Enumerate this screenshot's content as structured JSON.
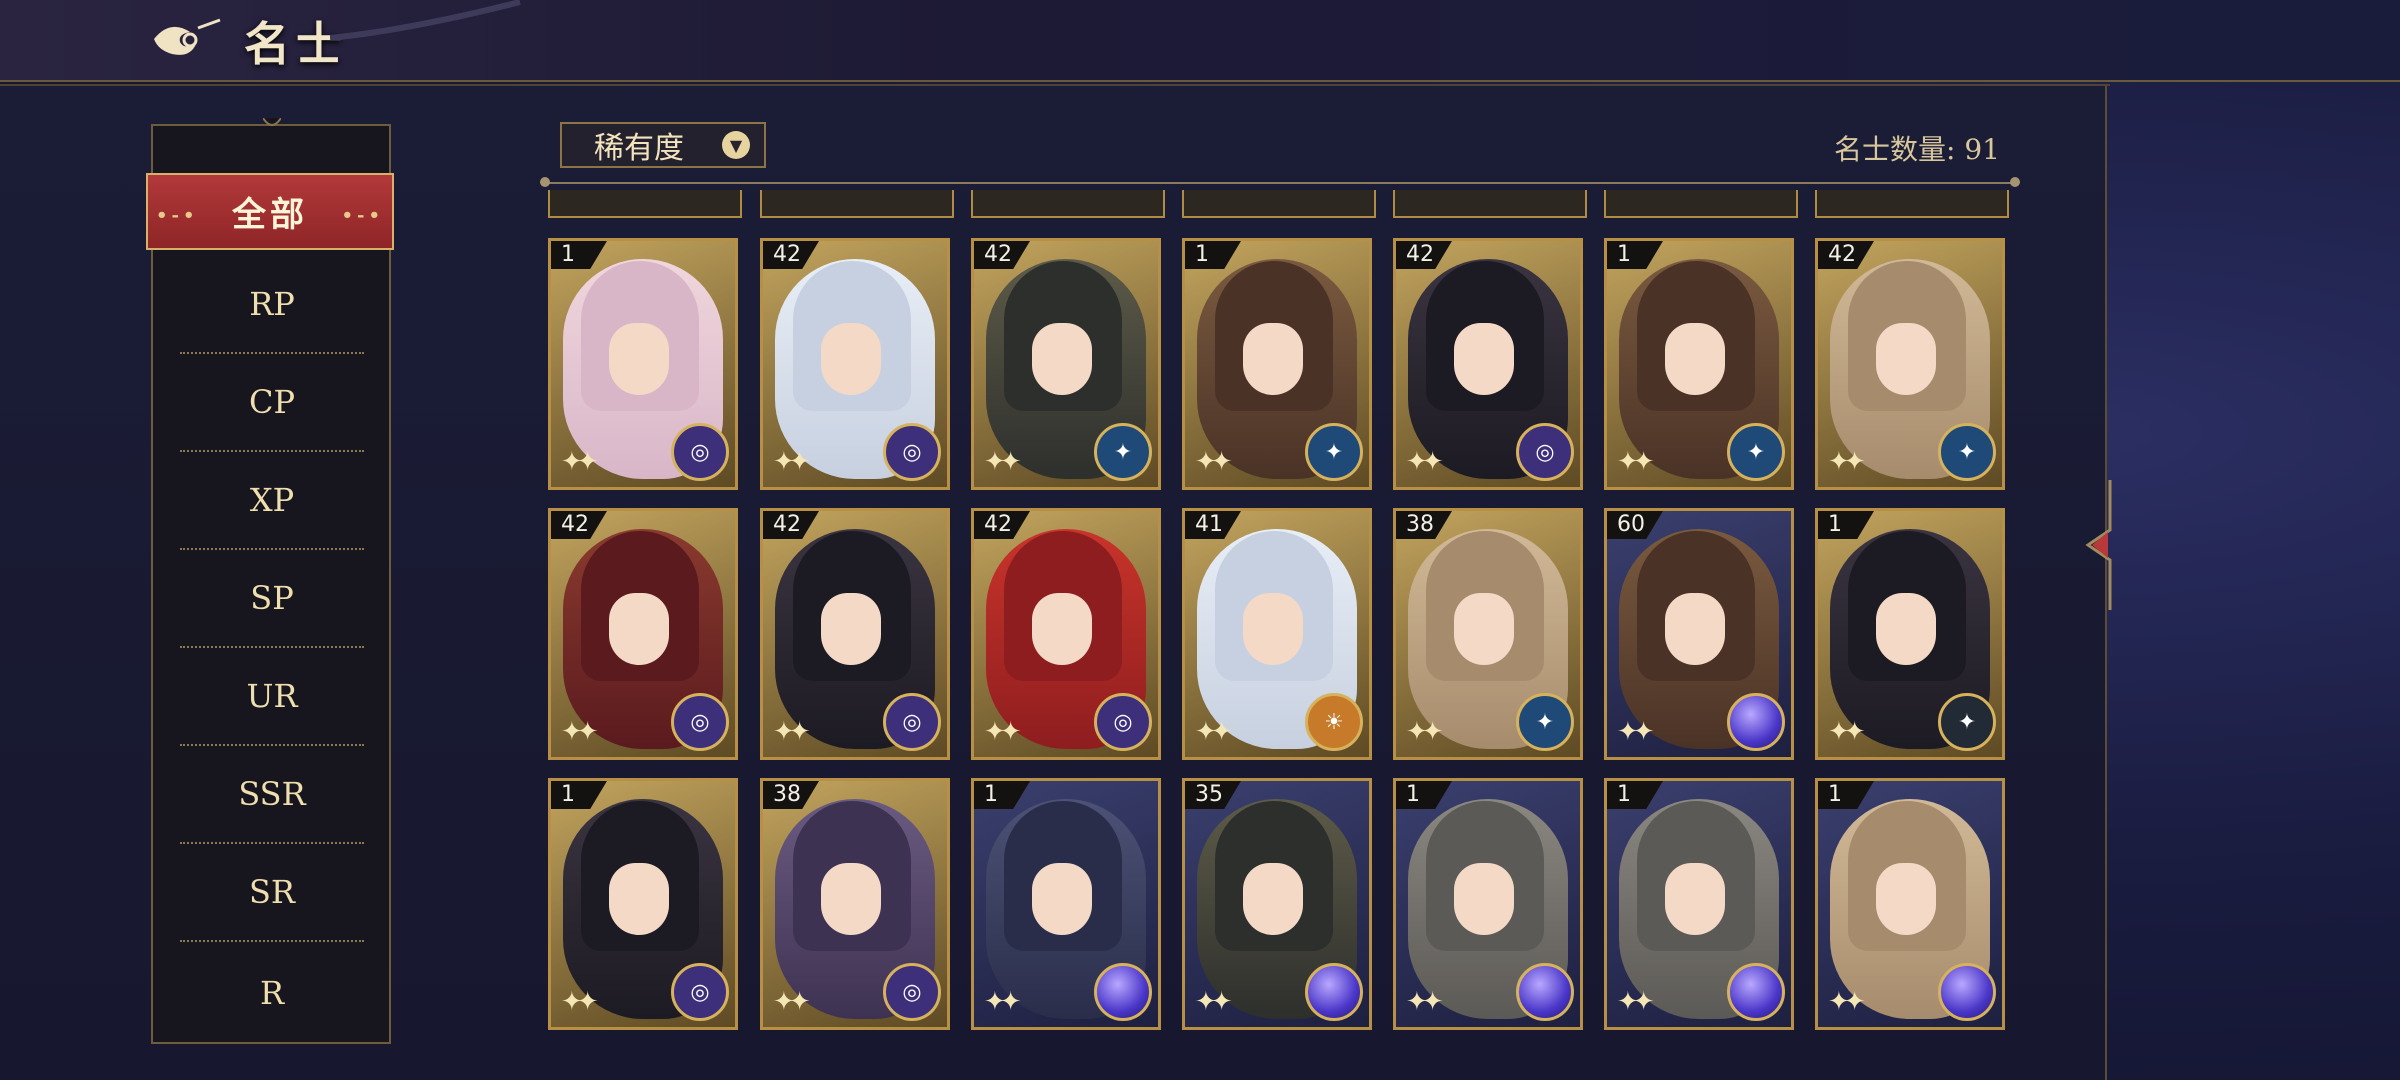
{
  "header": {
    "title": "名士"
  },
  "sidebar": {
    "active": "全部",
    "items": [
      "RP",
      "CP",
      "XP",
      "SP",
      "UR",
      "SSR",
      "SR",
      "R"
    ]
  },
  "toolbar": {
    "filter_label": "稀有度",
    "count_label": "名士数量:",
    "count_value": "91"
  },
  "colors": {
    "accent_gold": "#b89045",
    "active_red": "#9e2d2f",
    "panel_bg": "#17182f",
    "badge_purple": "#4a3a8a",
    "badge_blue": "#1f4a78",
    "badge_orb": "#5b49d6"
  },
  "cards": [
    {
      "level": "1",
      "badge": "purple-planet",
      "tone": "pink"
    },
    {
      "level": "42",
      "badge": "purple-planet",
      "tone": "silver"
    },
    {
      "level": "42",
      "badge": "blue-star",
      "tone": "dark"
    },
    {
      "level": "1",
      "badge": "blue-star",
      "tone": "brown"
    },
    {
      "level": "42",
      "badge": "purple-planet",
      "tone": "black"
    },
    {
      "level": "1",
      "badge": "blue-star",
      "tone": "brown"
    },
    {
      "level": "42",
      "badge": "blue-star",
      "tone": "tan"
    },
    {
      "level": "42",
      "badge": "purple-planet",
      "tone": "crimson"
    },
    {
      "level": "42",
      "badge": "purple-planet",
      "tone": "black"
    },
    {
      "level": "42",
      "badge": "purple-planet",
      "tone": "red"
    },
    {
      "level": "41",
      "badge": "orange-sun",
      "tone": "silver"
    },
    {
      "level": "38",
      "badge": "blue-star",
      "tone": "tan"
    },
    {
      "level": "60",
      "badge": "orb",
      "tone": "brown"
    },
    {
      "level": "1",
      "badge": "dark-star",
      "tone": "black"
    },
    {
      "level": "1",
      "badge": "purple-planet",
      "tone": "black"
    },
    {
      "level": "38",
      "badge": "purple-planet",
      "tone": "violet"
    },
    {
      "level": "1",
      "badge": "orb",
      "tone": "navy"
    },
    {
      "level": "35",
      "badge": "orb",
      "tone": "dark"
    },
    {
      "level": "1",
      "badge": "orb",
      "tone": "grey"
    },
    {
      "level": "1",
      "badge": "orb",
      "tone": "grey"
    },
    {
      "level": "1",
      "badge": "orb",
      "tone": "tan"
    }
  ]
}
